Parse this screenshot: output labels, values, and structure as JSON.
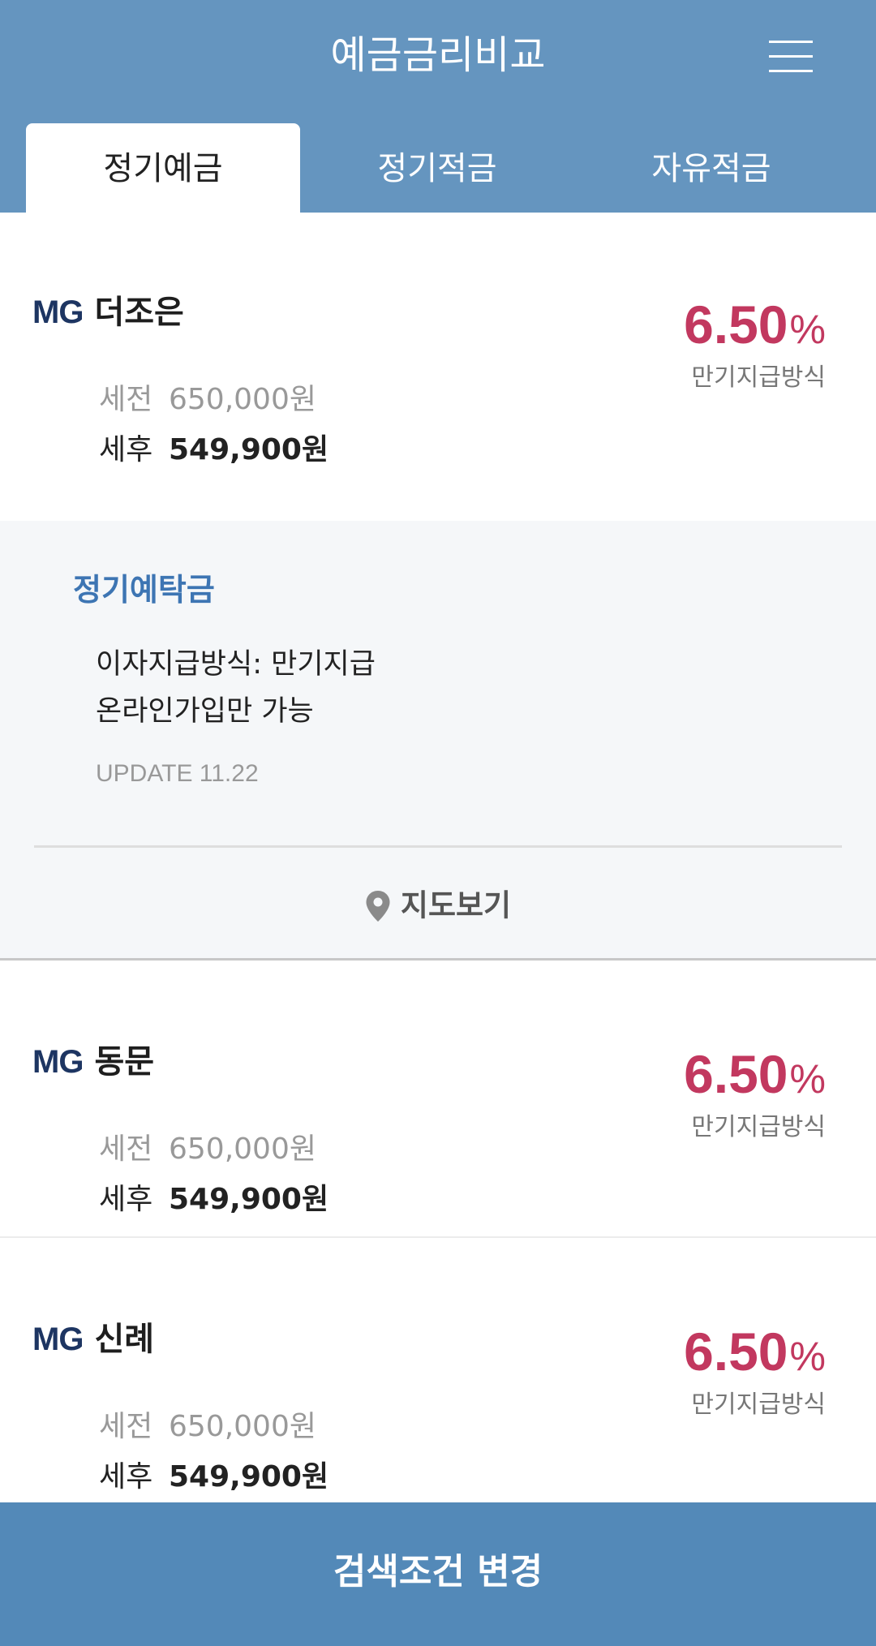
{
  "header": {
    "title": "예금금리비교",
    "menu_icon": "hamburger-menu-icon"
  },
  "tabs": [
    {
      "label": "정기예금",
      "active": true
    },
    {
      "label": "정기적금",
      "active": false
    },
    {
      "label": "자유적금",
      "active": false
    }
  ],
  "results": [
    {
      "brand": "MG",
      "bank": "더조은",
      "pre_label": "세전",
      "pre_amount": "650,000원",
      "post_label": "세후",
      "post_amount": "549,900원",
      "rate": "6.50",
      "rate_unit": "%",
      "method": "만기지급방식"
    },
    {
      "brand": "MG",
      "bank": "동문",
      "pre_label": "세전",
      "pre_amount": "650,000원",
      "post_label": "세후",
      "post_amount": "549,900원",
      "rate": "6.50",
      "rate_unit": "%",
      "method": "만기지급방식"
    },
    {
      "brand": "MG",
      "bank": "신례",
      "pre_label": "세전",
      "pre_amount": "650,000원",
      "post_label": "세후",
      "post_amount": "549,900원",
      "rate": "6.50",
      "rate_unit": "%",
      "method": "만기지급방식"
    }
  ],
  "detail": {
    "product_name": "정기예탁금",
    "line1": "이자지급방식: 만기지급",
    "line2": "온라인가입만 가능",
    "update": "UPDATE 11.22",
    "map_label": "지도보기",
    "map_icon": "map-pin-icon"
  },
  "footer": {
    "button_label": "검색조건 변경"
  },
  "colors": {
    "header_bg": "#6595bf",
    "rate": "#c2385f",
    "brand": "#1d3562",
    "product_title": "#3d75b3",
    "footer_bg": "#5389b8"
  }
}
